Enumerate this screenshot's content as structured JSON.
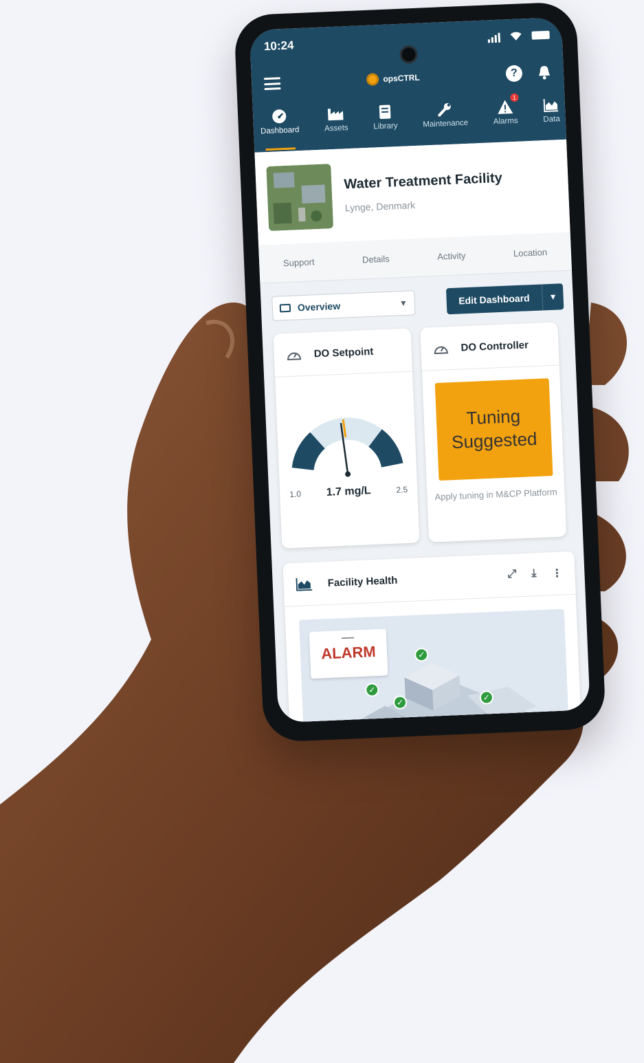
{
  "status": {
    "time": "10:24"
  },
  "app": {
    "brand": "opsCTRL"
  },
  "nav": [
    {
      "label": "Dashboard",
      "icon": "dashboard-icon",
      "active": true
    },
    {
      "label": "Assets",
      "icon": "factory-icon"
    },
    {
      "label": "Library",
      "icon": "book-icon"
    },
    {
      "label": "Maintenance",
      "icon": "wrench-icon"
    },
    {
      "label": "Alarms",
      "icon": "warning-icon",
      "badge": "1"
    },
    {
      "label": "Data",
      "icon": "chart-icon"
    }
  ],
  "facility": {
    "name": "Water Treatment Facility",
    "location": "Lynge, Denmark"
  },
  "subtabs": [
    "Support",
    "Details",
    "Activity",
    "Location"
  ],
  "view_select": {
    "value": "Overview"
  },
  "edit_button": {
    "label": "Edit Dashboard"
  },
  "do_setpoint": {
    "title": "DO Setpoint",
    "min_label": "1.0",
    "max_label": "2.5",
    "value_label": "1.7 mg/L",
    "value": 1.7,
    "min": 1.0,
    "max": 2.5
  },
  "do_controller": {
    "title": "DO Controller",
    "status": "Tuning Suggested",
    "note": "Apply tuning in M&CP Platform"
  },
  "facility_health": {
    "title": "Facility Health",
    "alarm_label": "ALARM"
  },
  "colors": {
    "header": "#1e4a63",
    "accent": "#f1a20e",
    "alarm": "#c0392b"
  }
}
